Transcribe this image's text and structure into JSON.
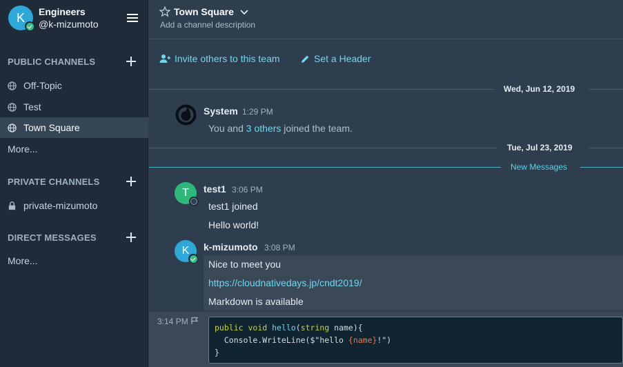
{
  "team": {
    "initial": "K",
    "name": "Engineers",
    "user": "@k-mizumoto"
  },
  "sidebar": {
    "public_header": "PUBLIC CHANNELS",
    "public_channels": [
      {
        "label": "Off-Topic"
      },
      {
        "label": "Test"
      },
      {
        "label": "Town Square"
      }
    ],
    "public_more": "More...",
    "private_header": "PRIVATE CHANNELS",
    "private_channels": [
      {
        "label": "private-mizumoto"
      }
    ],
    "dm_header": "DIRECT MESSAGES",
    "dm_more": "More..."
  },
  "channel": {
    "title": "Town Square",
    "description": "Add a channel description"
  },
  "intro": {
    "invite": "Invite others to this team",
    "header": "Set a Header"
  },
  "dates": {
    "first": "Wed, Jun 12, 2019",
    "second": "Tue, Jul 23, 2019",
    "new_messages": "New Messages"
  },
  "posts": {
    "system": {
      "name": "System",
      "time": "1:29 PM",
      "text_before": "You and ",
      "link": "3 others",
      "text_after": " joined the team."
    },
    "test1": {
      "initial": "T",
      "name": "test1",
      "time": "3:06 PM",
      "line1": "test1 joined",
      "line2": "Hello world!"
    },
    "kmizumoto": {
      "initial": "K",
      "name": "k-mizumoto",
      "time": "3:08 PM",
      "line1": "Nice to meet you",
      "link": "https://cloudnativedays.jp/cndt2019/",
      "line3": "Markdown is available"
    },
    "code_post": {
      "time": "3:14 PM",
      "code": {
        "l1_kw1": "public",
        "l1_kw2": "void",
        "l1_fn": "hello",
        "l1_p1": "(",
        "l1_kw3": "string",
        "l1_p2": " name){",
        "l2_a": "  Console.WriteLine($\"hello ",
        "l2_interp_open": "{",
        "l2_interp": "name",
        "l2_interp_close": "}",
        "l2_b": "!\")",
        "l3": "}"
      }
    }
  },
  "colors": {
    "accent": "#6fd7ee",
    "online": "#3db887",
    "sidebar_bg": "#1f2b38",
    "center_bg": "#2f3e4e"
  }
}
